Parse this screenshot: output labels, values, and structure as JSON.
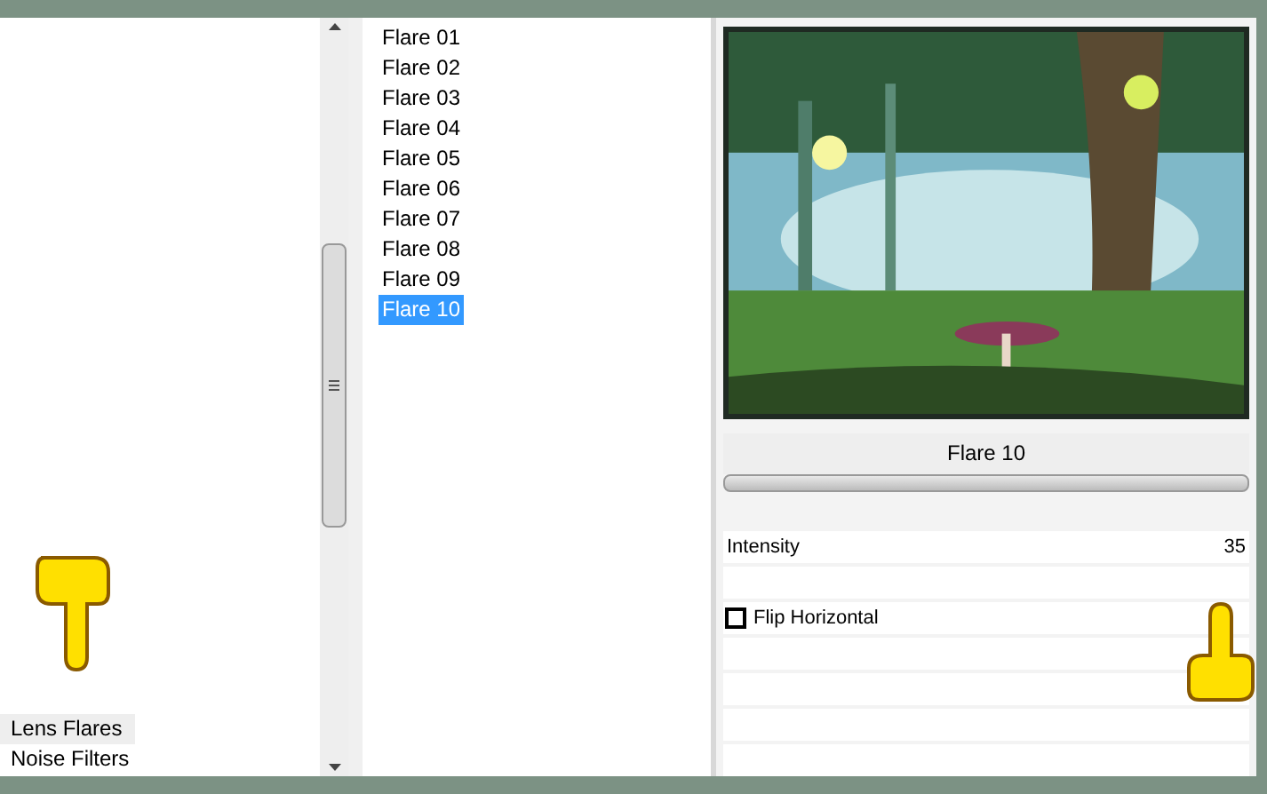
{
  "categories": [
    {
      "label": "Lens Flares",
      "selected": true
    },
    {
      "label": "Noise Filters",
      "selected": false
    }
  ],
  "effects": [
    {
      "label": "Flare 01",
      "selected": false
    },
    {
      "label": "Flare 02",
      "selected": false
    },
    {
      "label": "Flare 03",
      "selected": false
    },
    {
      "label": "Flare 04",
      "selected": false
    },
    {
      "label": "Flare 05",
      "selected": false
    },
    {
      "label": "Flare 06",
      "selected": false
    },
    {
      "label": "Flare 07",
      "selected": false
    },
    {
      "label": "Flare 08",
      "selected": false
    },
    {
      "label": "Flare 09",
      "selected": false
    },
    {
      "label": "Flare 10",
      "selected": true
    }
  ],
  "effect_name": "Flare 10",
  "intensity": {
    "label": "Intensity",
    "value": "35"
  },
  "flip_horizontal": {
    "label": "Flip Horizontal",
    "checked": false
  }
}
